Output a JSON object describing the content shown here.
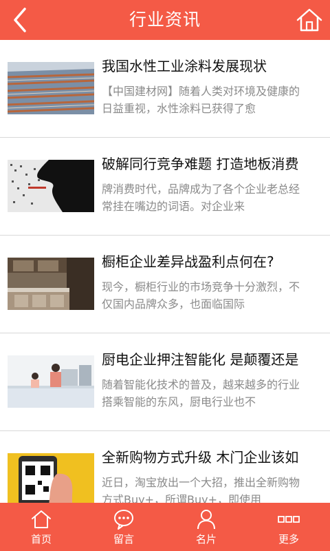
{
  "header": {
    "title": "行业资讯",
    "back_icon": "back-arrow-icon",
    "home_icon": "home-icon"
  },
  "articles": [
    {
      "title": "我国水性工业涂料发展现状",
      "summary": "【中国建材网】随着人类对环境及健康的日益重视，水性涂料已获得了愈",
      "thumb": "factory-roof-image"
    },
    {
      "title": "破解同行竞争难题 打造地板消费",
      "summary": "牌消费时代，品牌成为了各个企业老总经常挂在嘴边的词语。对企业来",
      "thumb": "hand-data-image"
    },
    {
      "title": "橱柜企业差异战盈利点何在?",
      "summary": "现今，橱柜行业的市场竞争十分激烈，不仅国内品牌众多，也面临国际",
      "thumb": "kitchen-image"
    },
    {
      "title": "厨电企业押注智能化 是颠覆还是",
      "summary": "随着智能化技术的普及，越来越多的行业搭乘智能的东风，厨电行业也不",
      "thumb": "family-kitchen-image"
    },
    {
      "title": "全新购物方式升级 木门企业该如",
      "summary": "近日，淘宝放出一个大招，推出全新购物方式Buy+，所谓Buy+，即使用",
      "thumb": "phone-qr-image"
    }
  ],
  "tabbar": [
    {
      "label": "首页",
      "icon": "home-icon"
    },
    {
      "label": "留言",
      "icon": "message-bubble-icon"
    },
    {
      "label": "名片",
      "icon": "person-icon"
    },
    {
      "label": "更多",
      "icon": "more-icon"
    }
  ],
  "colors": {
    "brand": "#f45a46",
    "title_text": "#111111",
    "summary_text": "#8a8a8a",
    "divider": "#d8d8d8"
  }
}
